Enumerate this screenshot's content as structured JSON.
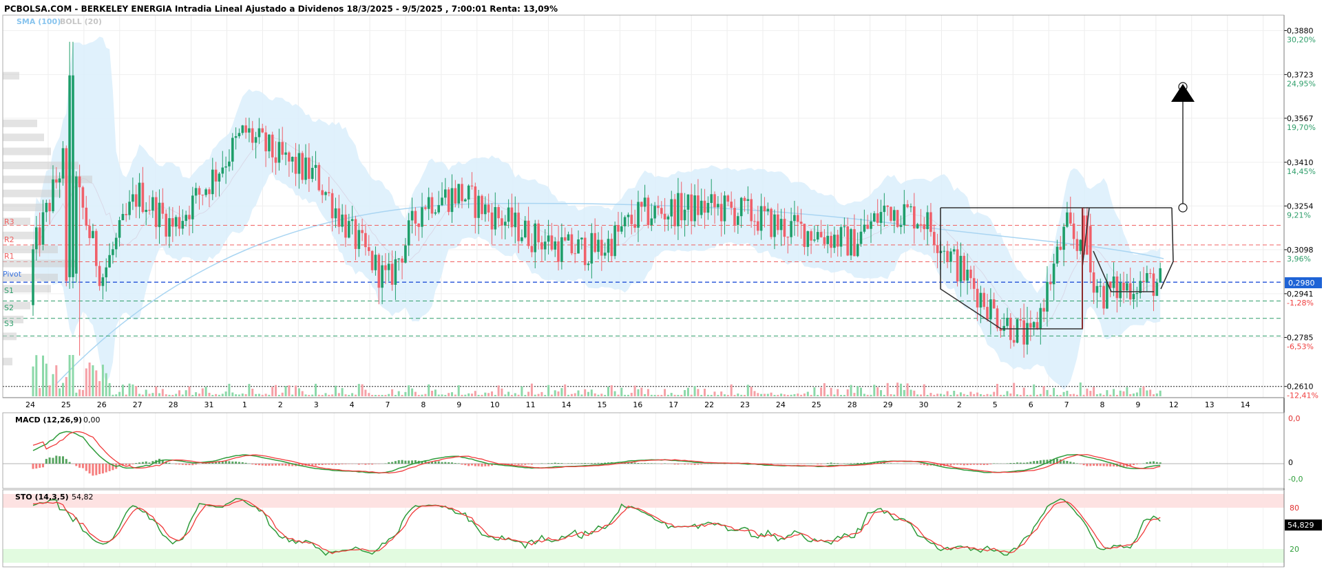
{
  "header": {
    "title": "PCBOLSA.COM - BERKELEY ENERGIA Intradia Lineal Ajustado a Dividenos 18/3/2025 - 9/5/2025 , 7:00:01 Renta: 13,09%",
    "indicators_label_sma": "SMA (100)",
    "indicators_label_boll": "BOLL (20)"
  },
  "colors": {
    "up": "#1e9e6a",
    "down": "#f0606a",
    "boll_fill": "#dbeefb",
    "sma": "#a9d5f2",
    "pivot": "#1f4fd8",
    "resistance": "#f06060",
    "support": "#2e9e6a",
    "pattern": "#333333",
    "macd_line": "#2e9b3a",
    "signal_line": "#f03a3a",
    "sto_overbought": "#fde2e2",
    "sto_oversold": "#e2fbe0"
  },
  "price_axis": {
    "ticks": [
      {
        "price": "0,3880",
        "pct": "30,20%",
        "pct_color": "#2e9e6a"
      },
      {
        "price": "0,3723",
        "pct": "24,95%",
        "pct_color": "#2e9e6a"
      },
      {
        "price": "0,3567",
        "pct": "19,70%",
        "pct_color": "#2e9e6a"
      },
      {
        "price": "0,3410",
        "pct": "14,45%",
        "pct_color": "#2e9e6a"
      },
      {
        "price": "0,3254",
        "pct": "9,21%",
        "pct_color": "#2e9e6a"
      },
      {
        "price": "0,3098",
        "pct": "3,96%",
        "pct_color": "#2e9e6a"
      },
      {
        "price": "0,2941",
        "pct": "-1,28%",
        "pct_color": "#f04040"
      },
      {
        "price": "0,2785",
        "pct": "-6,53%",
        "pct_color": "#f04040"
      },
      {
        "price": "0,2610",
        "pct": "-12,41%",
        "pct_color": "#f04040"
      }
    ],
    "current_price": "0,2980"
  },
  "levels": {
    "r3": "R3",
    "r2": "R2",
    "r1": "R1",
    "pivot": "Pivot",
    "s1": "S1",
    "s2": "S2",
    "s3": "S3"
  },
  "x_axis": {
    "labels": [
      "24",
      "25",
      "26",
      "27",
      "28",
      "31",
      "1",
      "2",
      "3",
      "4",
      "7",
      "8",
      "9",
      "10",
      "11",
      "14",
      "15",
      "16",
      "17",
      "22",
      "23",
      "24",
      "25",
      "28",
      "29",
      "30",
      "2",
      "5",
      "6",
      "7",
      "8",
      "9",
      "12",
      "13",
      "14"
    ]
  },
  "macd": {
    "label": "MACD (12,26,9)",
    "value": "0,00",
    "ticks": [
      {
        "text": "0,0",
        "color": "#e03030"
      },
      {
        "text": "0",
        "color": "#000000"
      },
      {
        "text": "-0,0",
        "color": "#2e9e3a"
      }
    ]
  },
  "sto": {
    "label": "STO (14,3,5)",
    "value": "54,82",
    "current": "54,829",
    "ticks": [
      {
        "text": "80",
        "color": "#e03030"
      },
      {
        "text": "20",
        "color": "#2e9e3a"
      }
    ]
  },
  "chart_data": {
    "type": "candlestick",
    "title": "PCBOLSA.COM - BERKELEY ENERGIA Intradia Lineal Ajustado a Dividenos 18/3/2025 - 9/5/2025 , 7:00:01 Renta: 13,09%",
    "ylim": [
      0.259,
      0.394
    ],
    "close_series": [
      {
        "x": "24",
        "close": 0.305
      },
      {
        "x": "25",
        "close": 0.345
      },
      {
        "x": "26",
        "close": 0.3
      },
      {
        "x": "27",
        "close": 0.33
      },
      {
        "x": "28",
        "close": 0.318
      },
      {
        "x": "31",
        "close": 0.334
      },
      {
        "x": "1",
        "close": 0.352
      },
      {
        "x": "2",
        "close": 0.342
      },
      {
        "x": "3",
        "close": 0.336
      },
      {
        "x": "4",
        "close": 0.315
      },
      {
        "x": "7",
        "close": 0.298
      },
      {
        "x": "8",
        "close": 0.327
      },
      {
        "x": "9",
        "close": 0.33
      },
      {
        "x": "10",
        "close": 0.322
      },
      {
        "x": "11",
        "close": 0.315
      },
      {
        "x": "14",
        "close": 0.31
      },
      {
        "x": "15",
        "close": 0.31
      },
      {
        "x": "16",
        "close": 0.322
      },
      {
        "x": "17",
        "close": 0.324
      },
      {
        "x": "22",
        "close": 0.325
      },
      {
        "x": "23",
        "close": 0.323
      },
      {
        "x": "24",
        "close": 0.318
      },
      {
        "x": "25",
        "close": 0.316
      },
      {
        "x": "28",
        "close": 0.312
      },
      {
        "x": "29",
        "close": 0.325
      },
      {
        "x": "30",
        "close": 0.321
      },
      {
        "x": "2",
        "close": 0.303
      },
      {
        "x": "5",
        "close": 0.287
      },
      {
        "x": "6",
        "close": 0.277
      },
      {
        "x": "7",
        "close": 0.318
      },
      {
        "x": "8",
        "close": 0.294
      },
      {
        "x": "9",
        "close": 0.298
      }
    ],
    "support_resistance": {
      "R3": 0.3185,
      "R2": 0.3115,
      "R1": 0.3055,
      "Pivot": 0.2982,
      "S1": 0.2915,
      "S2": 0.2853,
      "S3": 0.279
    },
    "last_price": 0.298,
    "macd_value": 0.0,
    "sto_value": 54.82,
    "sto_bands": [
      20,
      80
    ]
  }
}
